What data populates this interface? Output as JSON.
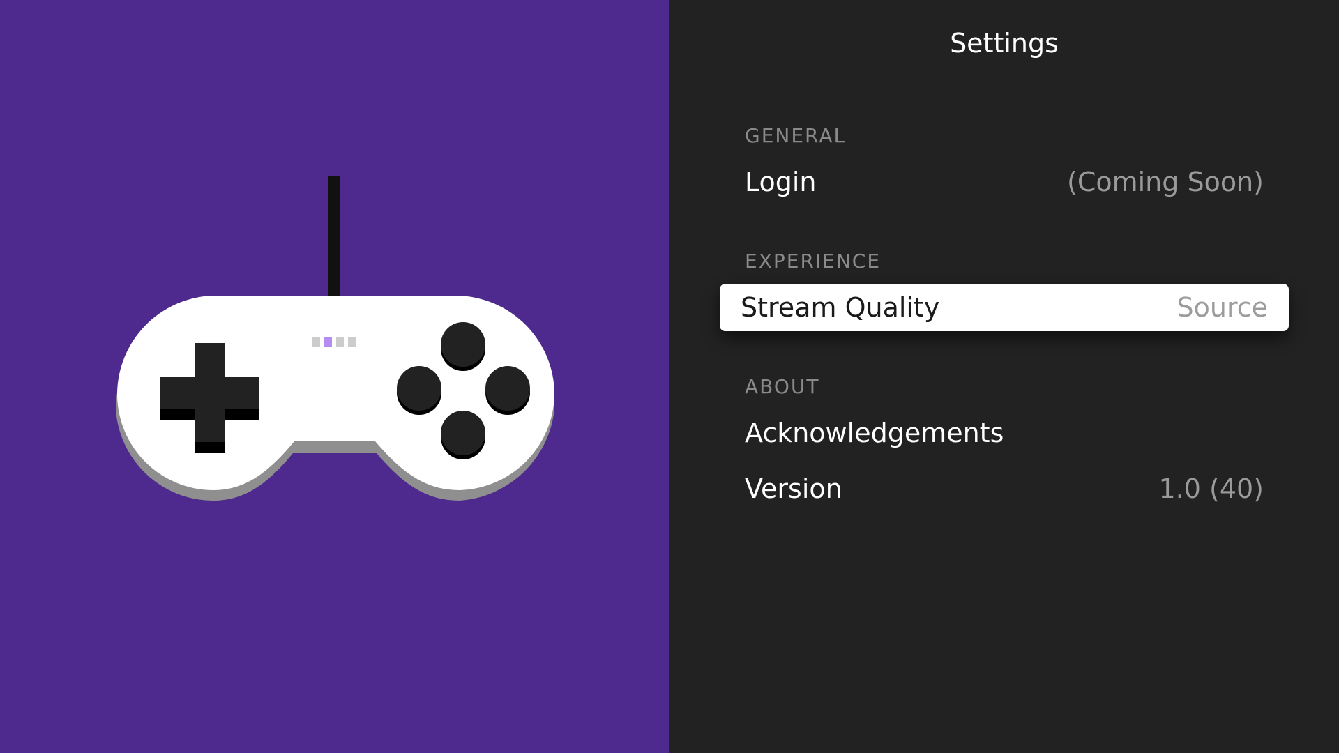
{
  "screen": {
    "title": "Settings"
  },
  "sections": {
    "general": {
      "header": "GENERAL",
      "login": {
        "label": "Login",
        "value": "(Coming Soon)"
      }
    },
    "experience": {
      "header": "EXPERIENCE",
      "stream_quality": {
        "label": "Stream Quality",
        "value": "Source",
        "focused": true
      }
    },
    "about": {
      "header": "ABOUT",
      "acknowledgements": {
        "label": "Acknowledgements"
      },
      "version": {
        "label": "Version",
        "value": "1.0 (40)"
      }
    }
  },
  "colors": {
    "art_background": "#4e2a8e",
    "panel_background": "#222222",
    "controller_body": "#ffffff",
    "controller_shadow": "#8f8f8f",
    "controller_buttons": "#222222",
    "indicator_active": "#b38ef0",
    "indicator_inactive": "#cccccc"
  },
  "artwork": {
    "icon": "gamepad-icon"
  }
}
